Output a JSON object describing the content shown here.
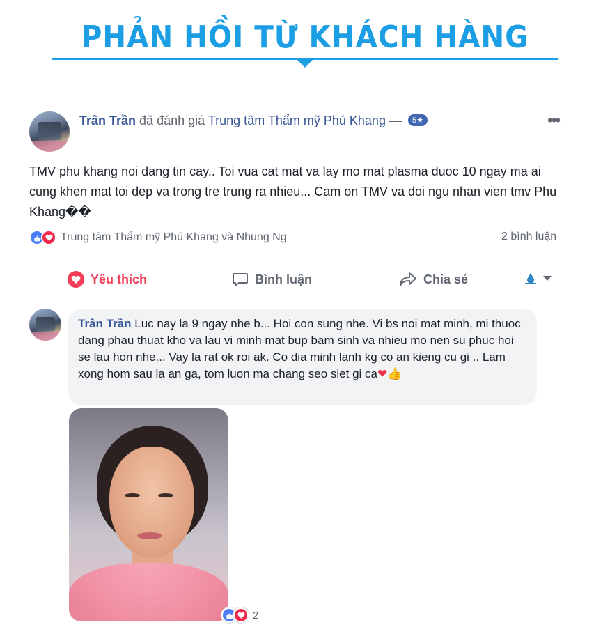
{
  "banner": {
    "title": "PHẢN HỒI TỪ KHÁCH HÀNG"
  },
  "post": {
    "author": "Trân Trần",
    "action_text": "đã đánh giá",
    "page_name": "Trung tâm Thẩm mỹ Phú Khang",
    "separator": "—",
    "rating_badge": "5★",
    "more_icon": "more-options-icon",
    "body": "TMV phu khang noi dang tin cay.. Toi vua cat mat va lay mo mat plasma duoc 10 ngay ma ai cung khen mat toi dep va trong tre trung ra nhieu... Cam on TMV va doi ngu nhan vien tmv Phu Khang��",
    "reactors": "Trung tâm Thẩm mỹ Phú Khang và Nhung Ng",
    "comment_count": "2 bình luận",
    "actions": {
      "like": "Yêu thích",
      "comment": "Bình luận",
      "share": "Chia sẻ"
    },
    "colors": {
      "accent": "#385898",
      "love": "#f33e58",
      "banner": "#1b9ee3"
    }
  },
  "comment": {
    "author": "Trân Trần",
    "text": "Luc nay la 9 ngay nhe b... Hoi con sung nhe. Vi bs noi mat minh, mi thuoc dang phau thuat kho va lau vi minh mat bup bam sinh va nhieu mo nen su phuc hoi se lau hon nhe... Vay la rat ok roi ak. Co dia minh lanh kg co an kieng cu gi .. Lam xong hom sau la an ga, tom luon ma chang seo siet gi ca",
    "emoji_heart": "❤",
    "emoji_thumb": "👍",
    "photo_reaction_count": "2"
  }
}
